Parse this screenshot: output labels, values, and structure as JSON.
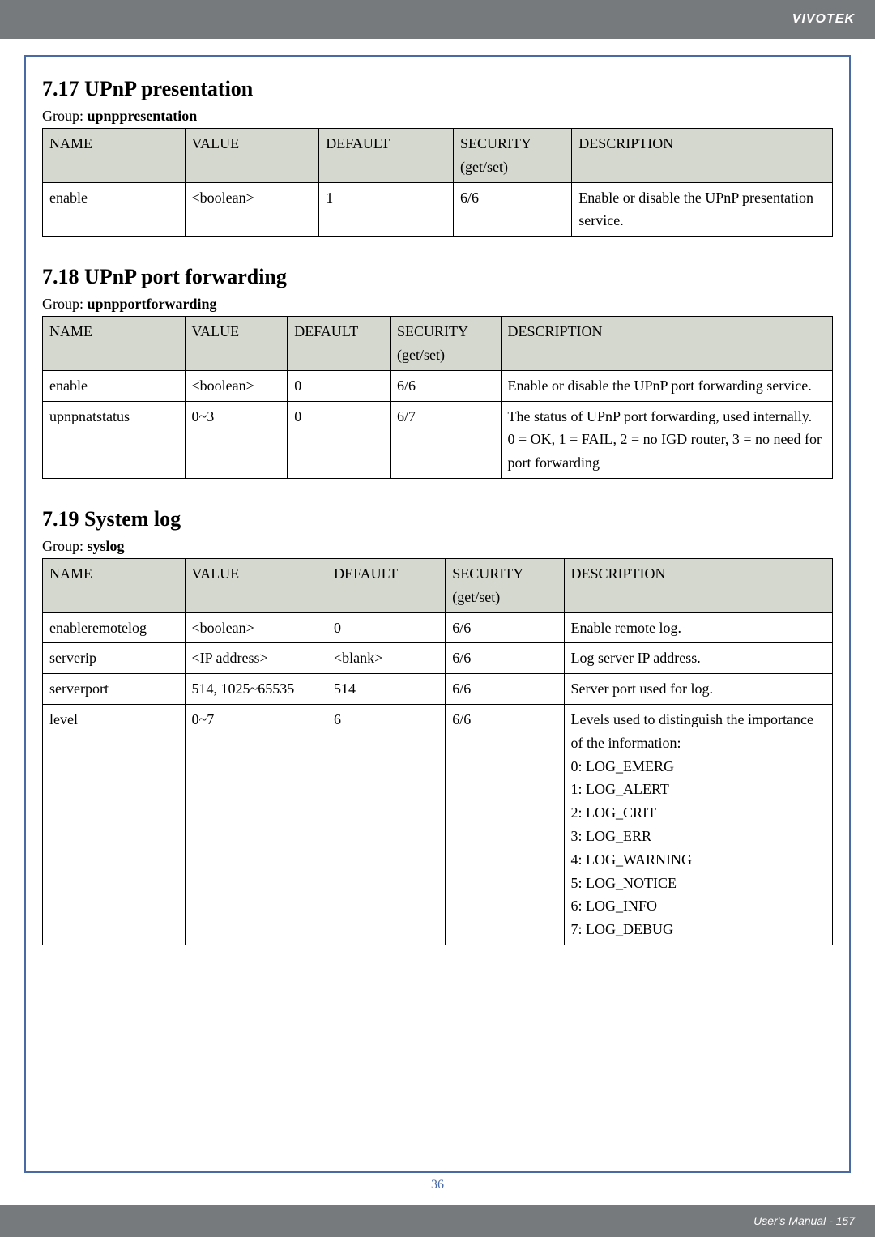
{
  "brand": "VIVOTEK",
  "inner_page_number": "36",
  "footer_text": "User's Manual - 157",
  "watermark_text": "VIVOTEK",
  "sections": {
    "s717": {
      "title": "7.17 UPnP presentation",
      "group_label": "Group: ",
      "group_name": "upnppresentation",
      "headers": {
        "name": "NAME",
        "value": "VALUE",
        "default": "DEFAULT",
        "security": "SECURITY (get/set)",
        "description": "DESCRIPTION"
      },
      "rows": [
        {
          "name": "enable",
          "value": "<boolean>",
          "default": "1",
          "security": "6/6",
          "description": "Enable or disable the UPnP presentation service."
        }
      ]
    },
    "s718": {
      "title": "7.18 UPnP port forwarding",
      "group_label": "Group: ",
      "group_name": "upnpportforwarding",
      "headers": {
        "name": "NAME",
        "value": "VALUE",
        "default": "DEFAULT",
        "security": "SECURITY (get/set)",
        "description": "DESCRIPTION"
      },
      "rows": [
        {
          "name": "enable",
          "value": "<boolean>",
          "default": "0",
          "security": "6/6",
          "description": "Enable or disable the UPnP port forwarding service."
        },
        {
          "name": "upnpnatstatus",
          "value": "0~3",
          "default": "0",
          "security": "6/7",
          "description": "The status of UPnP port forwarding, used internally.\n0 = OK, 1 = FAIL, 2 = no IGD router, 3 = no need for port forwarding"
        }
      ]
    },
    "s719": {
      "title": "7.19 System log",
      "group_label": "Group: ",
      "group_name": "syslog",
      "headers": {
        "name": "NAME",
        "value": "VALUE",
        "default": "DEFAULT",
        "security": "SECURITY (get/set)",
        "description": "DESCRIPTION"
      },
      "rows": [
        {
          "name": "enableremotelog",
          "value": "<boolean>",
          "default": "0",
          "security": "6/6",
          "description": "Enable remote log."
        },
        {
          "name": "serverip",
          "value": "<IP address>",
          "default": "<blank>",
          "security": "6/6",
          "description": "Log server IP address."
        },
        {
          "name": "serverport",
          "value": "514, 1025~65535",
          "default": "514",
          "security": "6/6",
          "description": "Server port used for log."
        },
        {
          "name": "level",
          "value": "0~7",
          "default": "6",
          "security": "6/6",
          "description": "Levels used to distinguish the importance of the information:\n0: LOG_EMERG\n1: LOG_ALERT\n2: LOG_CRIT\n3: LOG_ERR\n4: LOG_WARNING\n5: LOG_NOTICE\n6: LOG_INFO\n7: LOG_DEBUG"
        }
      ]
    }
  }
}
